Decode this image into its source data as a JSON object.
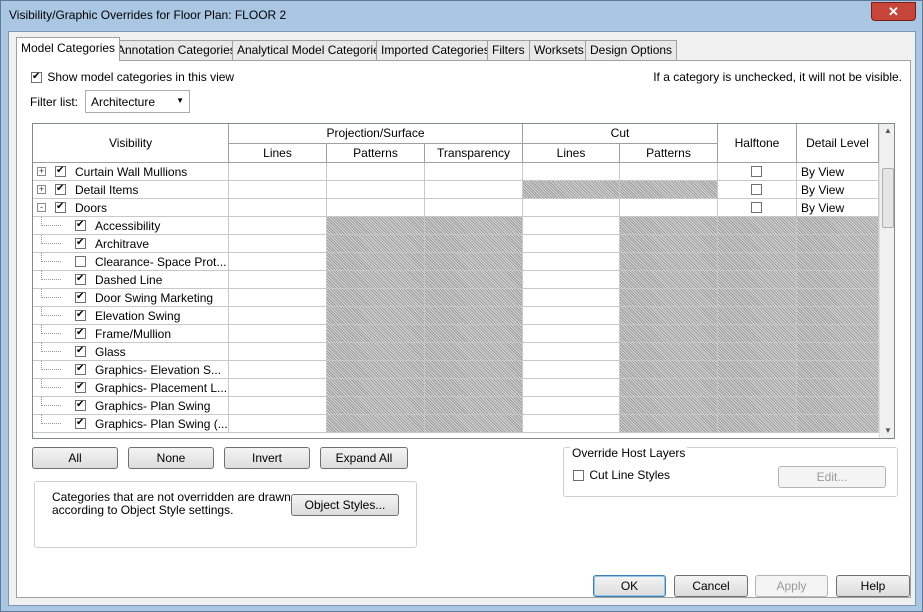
{
  "window": {
    "title": "Visibility/Graphic Overrides for Floor Plan: FLOOR 2",
    "close_label": "✕"
  },
  "tabs": [
    {
      "label": "Model Categories",
      "active": true
    },
    {
      "label": "Annotation Categories"
    },
    {
      "label": "Analytical Model Categories"
    },
    {
      "label": "Imported Categories"
    },
    {
      "label": "Filters"
    },
    {
      "label": "Worksets"
    },
    {
      "label": "Design Options"
    }
  ],
  "show_model": {
    "label": "Show model categories in this view",
    "checked": true
  },
  "hint": "If a category is unchecked, it will not be visible.",
  "filter": {
    "label": "Filter list:",
    "value": "Architecture"
  },
  "table": {
    "headers": {
      "visibility": "Visibility",
      "projection": "Projection/Surface",
      "cut": "Cut",
      "halftone": "Halftone",
      "detail_level": "Detail Level",
      "lines": "Lines",
      "patterns": "Patterns",
      "transparency": "Transparency",
      "cut_lines": "Lines",
      "cut_patterns": "Patterns"
    },
    "rows": [
      {
        "name": "Curtain Wall Mullions",
        "checked": true,
        "level": 0,
        "expander": "+",
        "detail": "By View"
      },
      {
        "name": "Detail Items",
        "checked": true,
        "level": 0,
        "expander": "+",
        "detail": "By View"
      },
      {
        "name": "Doors",
        "checked": true,
        "level": 0,
        "expander": "-",
        "detail": "By View"
      },
      {
        "name": "Accessibility",
        "checked": true,
        "level": 1
      },
      {
        "name": "Architrave",
        "checked": true,
        "level": 1
      },
      {
        "name": "Clearance- Space Prot...",
        "checked": false,
        "level": 1
      },
      {
        "name": "Dashed Line",
        "checked": true,
        "level": 1
      },
      {
        "name": "Door Swing Marketing",
        "checked": true,
        "level": 1
      },
      {
        "name": "Elevation Swing",
        "checked": true,
        "level": 1
      },
      {
        "name": "Frame/Mullion",
        "checked": true,
        "level": 1
      },
      {
        "name": "Glass",
        "checked": true,
        "level": 1
      },
      {
        "name": "Graphics- Elevation S...",
        "checked": true,
        "level": 1
      },
      {
        "name": "Graphics- Placement L...",
        "checked": true,
        "level": 1
      },
      {
        "name": "Graphics- Plan Swing",
        "checked": true,
        "level": 1
      },
      {
        "name": "Graphics- Plan Swing (...",
        "checked": true,
        "level": 1
      }
    ]
  },
  "buttons": {
    "all": "All",
    "none": "None",
    "invert": "Invert",
    "expand_all": "Expand All"
  },
  "override_host": {
    "title": "Override Host Layers",
    "cut_line_styles": "Cut Line Styles",
    "edit": "Edit..."
  },
  "note": {
    "line1": "Categories that are not overridden are drawn",
    "line2": "according to Object Style settings.",
    "object_styles": "Object Styles..."
  },
  "footer": {
    "ok": "OK",
    "cancel": "Cancel",
    "apply": "Apply",
    "help": "Help"
  }
}
